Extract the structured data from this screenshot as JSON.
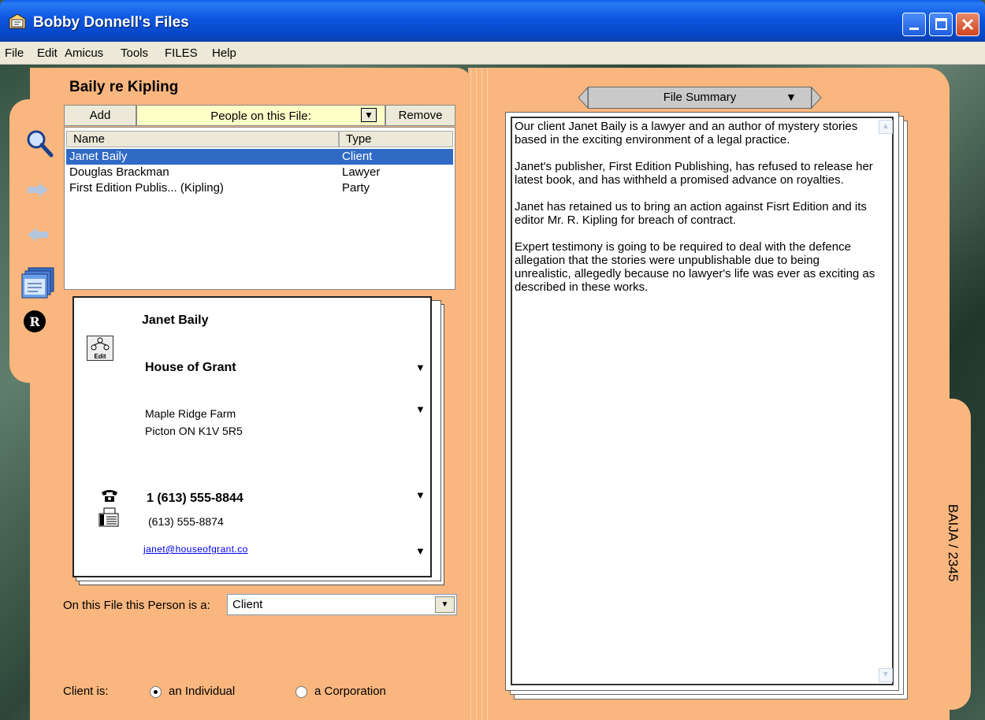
{
  "window": {
    "title": "Bobby Donnell's Files"
  },
  "menu": [
    "File",
    "Edit",
    "Amicus",
    "Tools",
    "FILES",
    "Help"
  ],
  "file": {
    "title": "Baily re Kipling",
    "id_label": "BAIJA / 2345"
  },
  "people": {
    "add_label": "Add",
    "dropdown_label": "People on this File:",
    "remove_label": "Remove",
    "columns": [
      "Name",
      "Type"
    ],
    "rows": [
      {
        "name": "Janet Baily",
        "type": "Client",
        "selected": true
      },
      {
        "name": "Douglas Brackman",
        "type": "Lawyer",
        "selected": false
      },
      {
        "name": "First Edition Publis... (Kipling)",
        "type": "Party",
        "selected": false
      }
    ]
  },
  "sidebar_icons": [
    "search-icon",
    "forward-arrow-icon",
    "back-arrow-icon",
    "calendar-icon",
    "registered-icon"
  ],
  "contact": {
    "name": "Janet Baily",
    "edit_label": "Edit",
    "company": "House of Grant",
    "address_line1": "Maple Ridge Farm",
    "address_line2": "Picton ON K1V 5R5",
    "phone": "1 (613) 555-8844",
    "fax": "(613) 555-8874",
    "email": "janet@houseofgrant.co"
  },
  "role": {
    "label": "On this File this Person is a:",
    "value": "Client"
  },
  "client_type": {
    "label": "Client is:",
    "options": [
      {
        "label": "an Individual",
        "checked": true
      },
      {
        "label": "a Corporation",
        "checked": false
      }
    ]
  },
  "summary": {
    "tab_label": "File Summary",
    "paragraphs": [
      "Our client Janet Baily is a lawyer and an author of mystery stories based in the exciting environment of a legal practice.",
      "Janet's publisher, First Edition Publishing, has refused to release her latest book, and has withheld a promised advance on royalties.",
      "Janet has retained us to bring an action against Fisrt Edition and its editor Mr. R. Kipling for breach of contract.",
      "Expert testimony is going to be required to deal with the defence allegation that the stories were unpublishable due to being unrealistic, allegedly because no lawyer's life was ever as exciting as described in these works."
    ]
  },
  "colors": {
    "folder": "#f9b67e",
    "selection": "#316ac5",
    "titlebar": "#0c55df"
  }
}
